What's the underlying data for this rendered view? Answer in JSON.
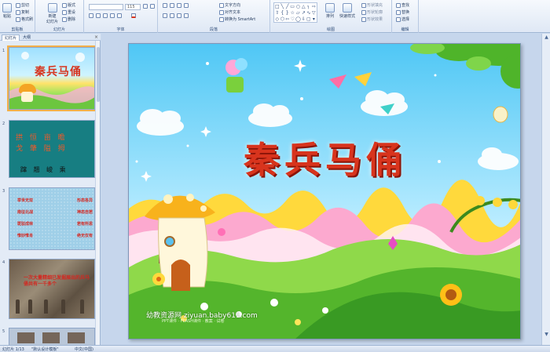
{
  "ribbon": {
    "groups": [
      {
        "label": "剪贴板"
      },
      {
        "label": "幻灯片"
      },
      {
        "label": "字体"
      },
      {
        "label": "段落"
      },
      {
        "label": "绘图"
      },
      {
        "label": "编辑"
      }
    ],
    "clipboard": {
      "paste": "粘贴",
      "cut": "剪切",
      "copy": "复制",
      "format_painter": "格式刷"
    },
    "slides": {
      "new_slide": "新建\n幻灯片",
      "layout": "版式",
      "reset": "重设",
      "delete": "删除"
    },
    "font": {
      "font_name": "",
      "font_size": "115"
    },
    "paragraph": {
      "text_direction": "文字方向",
      "align_text": "对齐文本",
      "smartart": "转换为 SmartArt"
    },
    "drawing": {
      "arrange": "排列",
      "quick_styles": "快速样式",
      "shape_fill": "形状填充",
      "shape_outline": "形状轮廓",
      "shape_effects": "形状效果"
    },
    "editing": {
      "find": "查找",
      "replace": "替换",
      "select": "选择"
    }
  },
  "panel": {
    "tabs": [
      {
        "label": "幻灯片"
      },
      {
        "label": "大纲"
      }
    ],
    "close": "×",
    "slide_numbers": [
      "1",
      "2",
      "3",
      "4",
      "5"
    ]
  },
  "thumbnails": {
    "t1_title": "秦兵马俑",
    "t2_line1": "拱 恒 亩 瞻",
    "t2_line2": "戈 肇 隘 拇",
    "t2_line3": "蹿 翘 峻 乘",
    "t3_rows": [
      [
        "举世无双",
        "形态各异"
      ],
      [
        "南征北战",
        "神态自若"
      ],
      [
        "斑驳成林",
        "若有所思"
      ],
      [
        "惟妙惟肖",
        "绝无仅有"
      ]
    ],
    "t4_text": "一次大量精细已发掘展出的兵马俑共有一千多个"
  },
  "slide": {
    "title": "秦兵马俑",
    "watermark": "幼教资源网 ziyuan.baby611.com",
    "watermark_sub": "PPT课件 · FLASH课件 · 教案 · 试卷"
  },
  "status": {
    "slide_counter": "幻灯片 1/13",
    "theme": "\"默认设计模板\"",
    "language": "中文(中国)"
  },
  "colors": {
    "title_red": "#d8341d",
    "ribbon_blue": "#dfe8f5",
    "selection_orange": "#f3b04a"
  }
}
